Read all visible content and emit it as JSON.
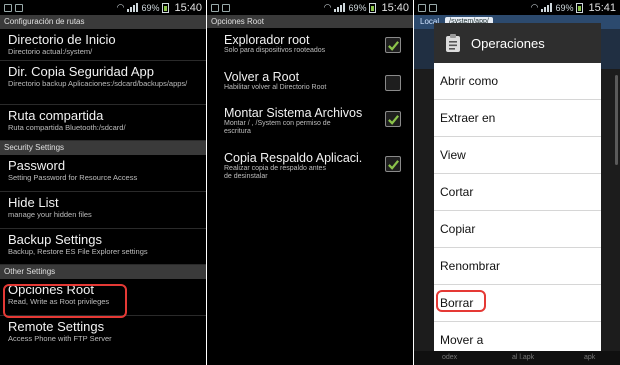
{
  "status_bars": [
    {
      "battery": "69%",
      "time": "15:40"
    },
    {
      "battery": "69%",
      "time": "15:40"
    },
    {
      "battery": "69%",
      "time": "15:41"
    }
  ],
  "panel1": {
    "section1": "Configuración de rutas",
    "items1": [
      {
        "title": "Directorio de Inicio",
        "summary": "Directorio actual:/system/"
      },
      {
        "title": "Dir. Copia Seguridad App",
        "summary": "Directorio backup Aplicaciones:/sdcard/backups/apps/"
      },
      {
        "title": "Ruta compartida",
        "summary": "Ruta compartida Bluetooth:/sdcard/"
      }
    ],
    "section2": "Security Settings",
    "items2": [
      {
        "title": "Password",
        "summary": "Setting Password for Resource Access"
      },
      {
        "title": "Hide List",
        "summary": "manage your hidden files"
      },
      {
        "title": "Backup Settings",
        "summary": "Backup, Restore ES File Explorer settings"
      }
    ],
    "section3": "Other Settings",
    "items3": [
      {
        "title": "Opciones Root",
        "summary": "Read, Write as Root privileges"
      },
      {
        "title": "Remote Settings",
        "summary": "Access Phone with FTP Server"
      }
    ]
  },
  "panel2": {
    "header": "Opciones Root",
    "options": [
      {
        "title": "Explorador root",
        "summary": "Solo para dispositivos rooteados",
        "checked": true
      },
      {
        "title": "Volver a Root",
        "summary": "Habilitar volver al Directorio Root",
        "checked": false
      },
      {
        "title": "Montar Sistema Archivos",
        "summary": "Montar / , /System con permiso de escritura",
        "checked": true
      },
      {
        "title": "Copia Respaldo Aplicaci.",
        "summary": "Realizar copia de respaldo antes de desinstalar",
        "checked": true
      }
    ]
  },
  "panel3": {
    "tab_label": "Local",
    "path": "/system/app/",
    "dialog_title": "Operaciones",
    "items": [
      "Abrir como",
      "Extraer en",
      "View",
      "Cortar",
      "Copiar",
      "Renombrar",
      "Borrar",
      "Mover a"
    ],
    "bottom_labels": [
      "odex",
      "al l.apk",
      "apk"
    ]
  },
  "colors": {
    "highlight": "#e53935",
    "check": "#8bc34a",
    "dialog_header": "#2e2e2e"
  }
}
